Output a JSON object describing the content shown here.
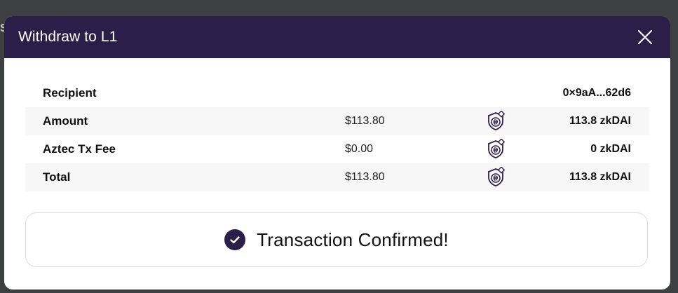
{
  "backdrop": {
    "hint_left": "S",
    "hint_left2": "S"
  },
  "modal": {
    "title": "Withdraw to L1",
    "close_icon": "close-icon"
  },
  "summary": {
    "rows": [
      {
        "label": "Recipient",
        "usd": "",
        "icon": "",
        "value": "0×9aA...62d6"
      },
      {
        "label": "Amount",
        "usd": "$113.80",
        "icon": "zkdai-token-icon",
        "value": "113.8 zkDAI"
      },
      {
        "label": "Aztec Tx Fee",
        "usd": "$0.00",
        "icon": "zkdai-token-icon",
        "value": "0 zkDAI"
      },
      {
        "label": "Total",
        "usd": "$113.80",
        "icon": "zkdai-token-icon",
        "value": "113.8 zkDAI"
      }
    ]
  },
  "status": {
    "icon": "check-circle-icon",
    "text": "Transaction Confirmed!"
  },
  "colors": {
    "header_bg": "#2b1f49",
    "check_bg": "#2b1f49",
    "backdrop": "#3d3f41"
  }
}
